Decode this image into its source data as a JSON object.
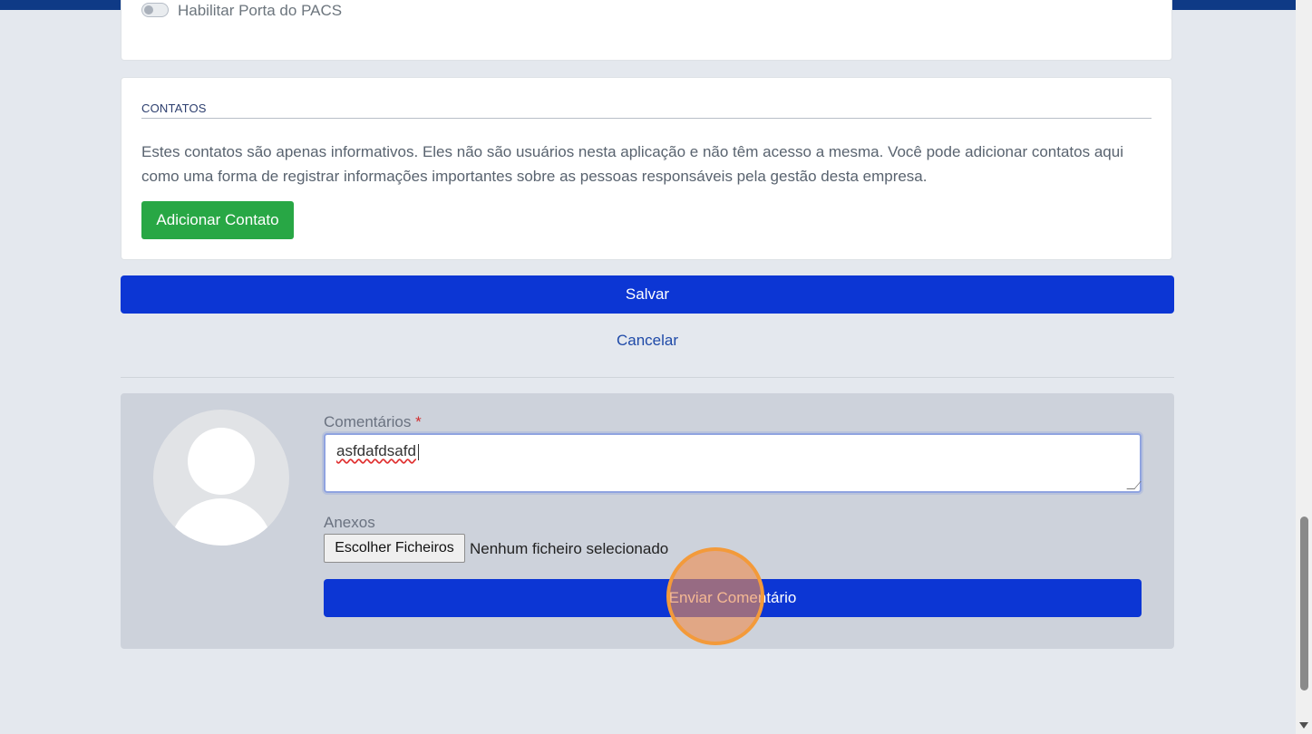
{
  "top_section": {
    "toggle_label": "Habilitar Porta do PACS"
  },
  "contacts": {
    "title": "CONTATOS",
    "description": "Estes contatos são apenas informativos. Eles não são usuários nesta aplicação e não têm acesso a mesma. Você pode adicionar contatos aqui como uma forma de registrar informações importantes sobre as pessoas responsáveis pela gestão desta empresa.",
    "add_button": "Adicionar Contato"
  },
  "actions": {
    "save": "Salvar",
    "cancel": "Cancelar"
  },
  "comments": {
    "label": "Comentários",
    "required_mark": "*",
    "value": "asfdafdsafd",
    "attachments_label": "Anexos",
    "file_button": "Escolher Ficheiros",
    "file_status": "Nenhum ficheiro selecionado",
    "submit": "Enviar Comentário"
  },
  "colors": {
    "primary": "#0c36d4",
    "success": "#28a745",
    "header": "#0f3a86",
    "click_marker": "#f39a3a"
  }
}
